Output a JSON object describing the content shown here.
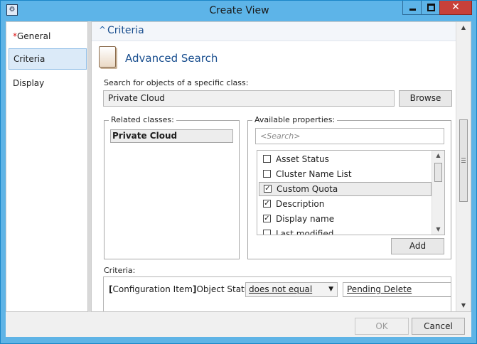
{
  "window": {
    "title": "Create View",
    "close_glyph": "✕"
  },
  "nav": {
    "items": [
      {
        "label": "General",
        "required": true
      },
      {
        "label": "Criteria"
      },
      {
        "label": "Display"
      }
    ]
  },
  "criteria_section": {
    "header": "Criteria",
    "advanced_title": "Advanced Search",
    "search_label": "Search for objects of a specific class:",
    "class_value": "Private Cloud",
    "browse_label": "Browse",
    "related_legend": "Related classes:",
    "related_items": [
      "Private Cloud"
    ],
    "available_legend": "Available properties:",
    "search_placeholder": "<Search>",
    "properties": [
      {
        "label": "Asset Status",
        "checked": false
      },
      {
        "label": "Cluster Name List",
        "checked": false
      },
      {
        "label": "Custom Quota",
        "checked": true,
        "selected": true
      },
      {
        "label": "Description",
        "checked": true
      },
      {
        "label": "Display name",
        "checked": true
      },
      {
        "label": "Last modified",
        "checked": false
      }
    ],
    "add_label": "Add",
    "criteria_label": "Criteria:",
    "criteria_row": {
      "bracket_open": "[",
      "class": "Configuration Item",
      "bracket_close": "]",
      "property": "Object Status",
      "operator": "does not equal",
      "value": "Pending Delete"
    }
  },
  "footer": {
    "ok_label": "OK",
    "cancel_label": "Cancel",
    "ok_enabled": false
  }
}
